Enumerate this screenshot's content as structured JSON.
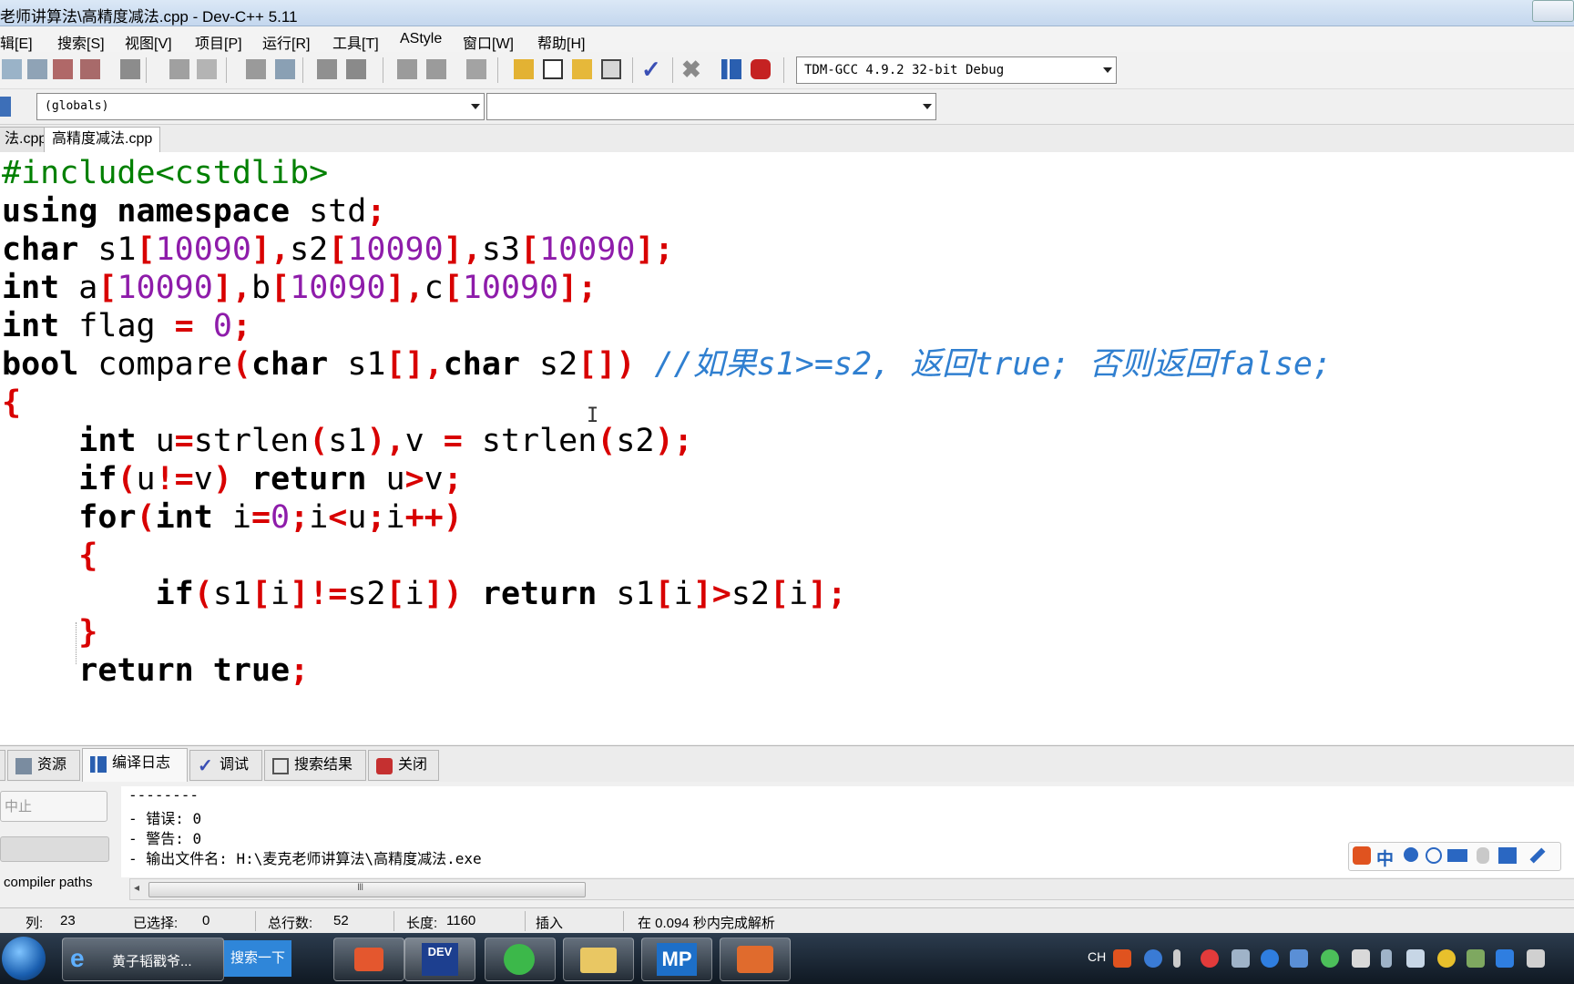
{
  "window": {
    "title": "老师讲算法\\高精度减法.cpp - Dev-C++ 5.11"
  },
  "menu": [
    "辑[E]",
    "搜索[S]",
    "视图[V]",
    "项目[P]",
    "运行[R]",
    "工具[T]",
    "AStyle",
    "窗口[W]",
    "帮助[H]"
  ],
  "toolbar": {
    "compiler": "TDM-GCC 4.9.2 32-bit Debug"
  },
  "classbar": {
    "scope": "(globals)",
    "member": ""
  },
  "file_tabs": [
    {
      "label": "法.cpp"
    },
    {
      "label": "高精度减法.cpp"
    }
  ],
  "editor": {
    "lines": [
      [
        [
          "pp",
          "#include<cstdlib>"
        ]
      ],
      [
        [
          "kw",
          "using namespace "
        ],
        [
          "id",
          "std"
        ],
        [
          "sy",
          ";"
        ]
      ],
      [
        [
          "kw",
          "char "
        ],
        [
          "id",
          "s1"
        ],
        [
          "sy",
          "["
        ],
        [
          "nm",
          "10090"
        ],
        [
          "sy",
          "],"
        ],
        [
          "id",
          "s2"
        ],
        [
          "sy",
          "["
        ],
        [
          "nm",
          "10090"
        ],
        [
          "sy",
          "],"
        ],
        [
          "id",
          "s3"
        ],
        [
          "sy",
          "["
        ],
        [
          "nm",
          "10090"
        ],
        [
          "sy",
          "];"
        ]
      ],
      [
        [
          "kw",
          "int "
        ],
        [
          "id",
          "a"
        ],
        [
          "sy",
          "["
        ],
        [
          "nm",
          "10090"
        ],
        [
          "sy",
          "],"
        ],
        [
          "id",
          "b"
        ],
        [
          "sy",
          "["
        ],
        [
          "nm",
          "10090"
        ],
        [
          "sy",
          "],"
        ],
        [
          "id",
          "c"
        ],
        [
          "sy",
          "["
        ],
        [
          "nm",
          "10090"
        ],
        [
          "sy",
          "];"
        ]
      ],
      [
        [
          "kw",
          "int "
        ],
        [
          "id",
          "flag "
        ],
        [
          "sy",
          "= "
        ],
        [
          "nm",
          "0"
        ],
        [
          "sy",
          ";"
        ]
      ],
      [
        [
          "kw",
          "bool "
        ],
        [
          "id",
          "compare"
        ],
        [
          "sy",
          "("
        ],
        [
          "kw",
          "char "
        ],
        [
          "id",
          "s1"
        ],
        [
          "sy",
          "[],"
        ],
        [
          "kw",
          "char "
        ],
        [
          "id",
          "s2"
        ],
        [
          "sy",
          "[]) "
        ],
        [
          "cm",
          "//如果s1>=s2, 返回true; 否则返回false;"
        ]
      ],
      [
        [
          "sy",
          "{"
        ]
      ],
      [
        [
          "id",
          "    "
        ],
        [
          "kw",
          "int "
        ],
        [
          "id",
          "u"
        ],
        [
          "sy",
          "="
        ],
        [
          "id",
          "strlen"
        ],
        [
          "sy",
          "("
        ],
        [
          "id",
          "s1"
        ],
        [
          "sy",
          "),"
        ],
        [
          "id",
          "v "
        ],
        [
          "sy",
          "= "
        ],
        [
          "id",
          "strlen"
        ],
        [
          "sy",
          "("
        ],
        [
          "id",
          "s2"
        ],
        [
          "sy",
          ");"
        ]
      ],
      [
        [
          "id",
          "    "
        ],
        [
          "kw",
          "if"
        ],
        [
          "sy",
          "("
        ],
        [
          "id",
          "u"
        ],
        [
          "sy",
          "!="
        ],
        [
          "id",
          "v"
        ],
        [
          "sy",
          ") "
        ],
        [
          "kw",
          "return "
        ],
        [
          "id",
          "u"
        ],
        [
          "sy",
          ">"
        ],
        [
          "id",
          "v"
        ],
        [
          "sy",
          ";"
        ]
      ],
      [
        [
          "id",
          "    "
        ],
        [
          "kw",
          "for"
        ],
        [
          "sy",
          "("
        ],
        [
          "kw",
          "int "
        ],
        [
          "id",
          "i"
        ],
        [
          "sy",
          "="
        ],
        [
          "nm",
          "0"
        ],
        [
          "sy",
          ";"
        ],
        [
          "id",
          "i"
        ],
        [
          "sy",
          "<"
        ],
        [
          "id",
          "u"
        ],
        [
          "sy",
          ";"
        ],
        [
          "id",
          "i"
        ],
        [
          "sy",
          "++)"
        ]
      ],
      [
        [
          "id",
          "    "
        ],
        [
          "sy",
          "{"
        ]
      ],
      [
        [
          "id",
          "        "
        ],
        [
          "kw",
          "if"
        ],
        [
          "sy",
          "("
        ],
        [
          "id",
          "s1"
        ],
        [
          "sy",
          "["
        ],
        [
          "id",
          "i"
        ],
        [
          "sy",
          "]!="
        ],
        [
          "id",
          "s2"
        ],
        [
          "sy",
          "["
        ],
        [
          "id",
          "i"
        ],
        [
          "sy",
          "]) "
        ],
        [
          "kw",
          "return "
        ],
        [
          "id",
          "s1"
        ],
        [
          "sy",
          "["
        ],
        [
          "id",
          "i"
        ],
        [
          "sy",
          "]>"
        ],
        [
          "id",
          "s2"
        ],
        [
          "sy",
          "["
        ],
        [
          "id",
          "i"
        ],
        [
          "sy",
          "];"
        ]
      ],
      [
        [
          "id",
          "    "
        ],
        [
          "sy",
          "}"
        ]
      ],
      [
        [
          "id",
          "    "
        ],
        [
          "kw",
          "return true"
        ],
        [
          "sy",
          ";"
        ]
      ]
    ]
  },
  "bottom_tabs": [
    "资源",
    "编译日志",
    "调试",
    "搜索结果",
    "关闭"
  ],
  "side_buttons": {
    "stop": "中止",
    "compiler_paths": "compiler paths"
  },
  "log": [
    "--------",
    "- 错误: 0",
    "- 警告: 0",
    "- 输出文件名: H:\\麦克老师讲算法\\高精度减法.exe"
  ],
  "scrollbar": {
    "thumb_glyph": "III"
  },
  "ime": {
    "label": "中"
  },
  "status": {
    "col_label": "列:",
    "col": "23",
    "sel_label": "已选择:",
    "sel": "0",
    "lines_label": "总行数:",
    "lines": "52",
    "len_label": "长度:",
    "len": "1160",
    "mode": "插入",
    "parse": "在 0.094 秒内完成解析"
  },
  "taskbar": {
    "task1": "黄子韬戳爷...",
    "search": "搜索一下",
    "dev_label": "DEV",
    "mp_label": "MP",
    "lang": "CH"
  }
}
